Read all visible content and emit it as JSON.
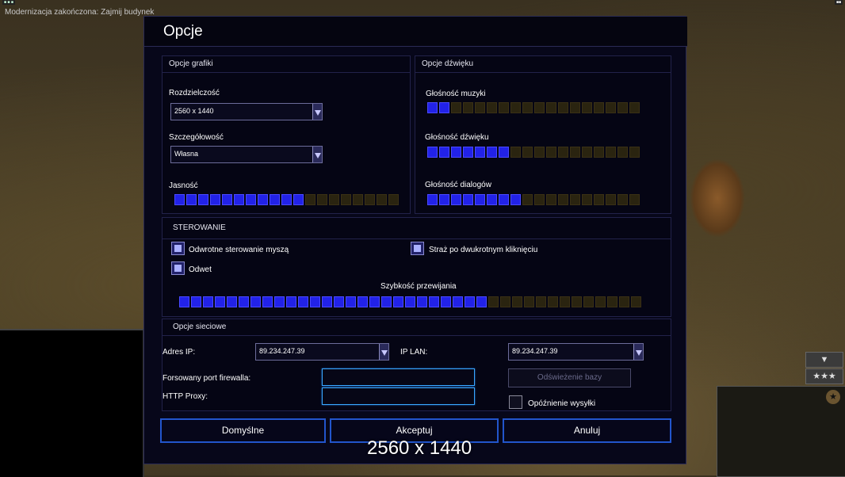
{
  "hud": {
    "message": "Modernizacja zakończona: Zajmij budynek",
    "side_arrow": "▼",
    "side_stars": "★★★",
    "radar_star": "★"
  },
  "dialog": {
    "title": "Opcje",
    "graphics": {
      "header": "Opcje grafiki",
      "resolution_label": "Rozdzielczość",
      "resolution_value": "2560 x 1440",
      "detail_label": "Szczegółowość",
      "detail_value": "Własna",
      "brightness_label": "Jasność",
      "brightness_level": 0.59
    },
    "sound": {
      "header": "Opcje dźwięku",
      "music_label": "Głośność muzyki",
      "music_level": 0.11,
      "sound_label": "Głośność dźwięku",
      "sound_level": 0.41,
      "dialog_label": "Głośność dialogów",
      "dialog_level": 0.44
    },
    "controls": {
      "header": "STEROWANIE",
      "invert_mouse_label": "Odwrotne sterowanie myszą",
      "invert_mouse_checked": true,
      "guard_label": "Straż po dwukrotnym kliknięciu",
      "guard_checked": true,
      "retaliation_label": "Odwet",
      "retaliation_checked": true,
      "scroll_label": "Szybkość przewijania",
      "scroll_level": 0.67
    },
    "network": {
      "header": "Opcje sieciowe",
      "ip_label": "Adres IP:",
      "ip_value": "89.234.247.39",
      "lan_label": "IP LAN:",
      "lan_value": "89.234.247.39",
      "firewall_label": "Forsowany port firewalla:",
      "firewall_value": "",
      "proxy_label": "HTTP Proxy:",
      "proxy_value": "",
      "refresh_label": "Odświeżenie bazy",
      "delay_label": "Opóźnienie wysyłki",
      "delay_checked": false
    },
    "buttons": {
      "defaults": "Domyślne",
      "accept": "Akceptuj",
      "cancel": "Anuluj"
    }
  },
  "overlay_text": "2560 x 1440",
  "colors": {
    "slider_on": "#2222e8",
    "slider_off": "#2a2410",
    "accent_border": "#2255cc",
    "field_border": "#39a7ff"
  }
}
